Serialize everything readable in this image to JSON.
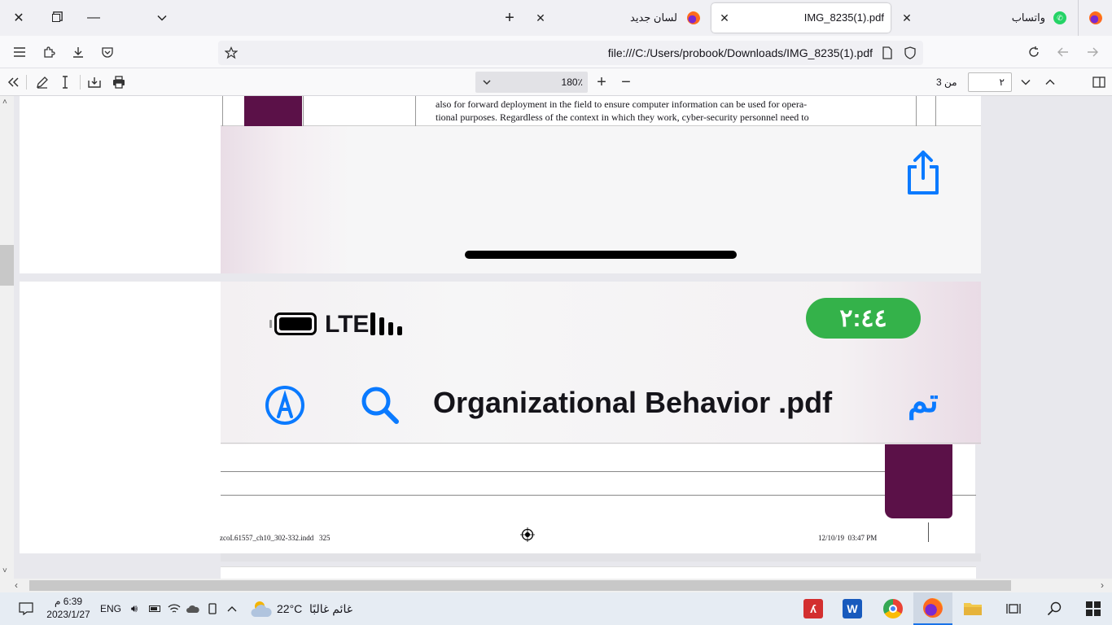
{
  "browser": {
    "tabs": [
      {
        "title": "واتساب",
        "icon": "whatsapp-icon",
        "active": false
      },
      {
        "title": "IMG_8235(1).pdf",
        "icon": "pdf-tab-icon",
        "active": true
      },
      {
        "title": "لسان جديد",
        "icon": "firefox-icon",
        "active": false
      }
    ],
    "url": "file:///C:/Users/probook/Downloads/IMG_8235(1).pdf"
  },
  "pdf_toolbar": {
    "zoom": "180٪",
    "page_current": "٢",
    "page_total_label": "من 3"
  },
  "document": {
    "text_line_1": "also for forward deployment in the field to ensure computer information can be used for opera-",
    "text_line_2": "tional purposes. Regardless of the context in which they work, cyber-security personnel need to",
    "phone_time": "٢:٤٤",
    "phone_network": "LTE",
    "phone_done": "تم",
    "phone_doc_title": "Organizational Behavior .pdf",
    "footer_file": "zcoL61557_ch10_302-332.indd   325",
    "footer_date": "12/10/19  03:47 PM"
  },
  "taskbar": {
    "time": "6:39 م",
    "date": "2023/1/27",
    "lang": "ENG",
    "weather_temp": "22°C",
    "weather_desc": "غائم غالبًا"
  },
  "colors": {
    "accent_blue": "#0a7aff",
    "phone_green": "#34b24a",
    "plum": "#5b1148"
  }
}
